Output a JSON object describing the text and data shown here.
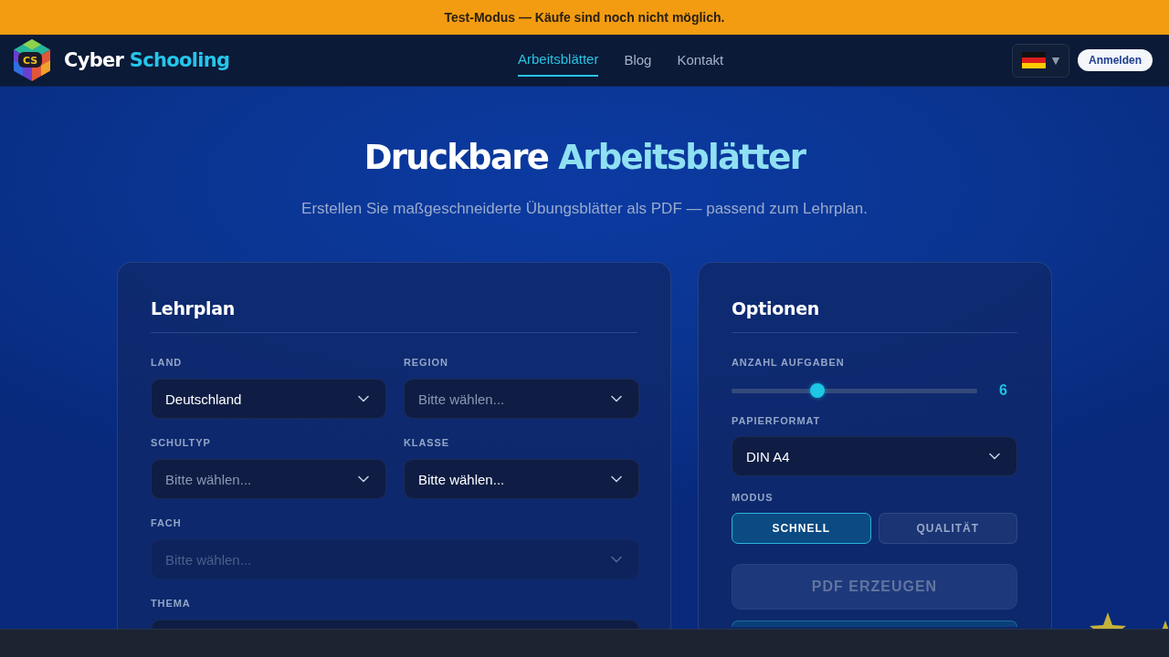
{
  "notice": {
    "text": "Test-Modus — Käufe sind noch nicht möglich."
  },
  "header": {
    "logo": {
      "mark": "CS",
      "name": [
        {
          "text": "Cyber ",
          "accent": false
        },
        {
          "text": "Schooling",
          "accent": true
        }
      ]
    },
    "nav": [
      {
        "label": "Arbeitsblätter",
        "selected": true
      },
      {
        "label": "Blog",
        "selected": false
      },
      {
        "label": "Kontakt",
        "selected": false
      }
    ],
    "language": {
      "caret": "▼"
    },
    "login_button": {
      "label": "Anmelden"
    }
  },
  "hero": {
    "title": [
      {
        "text": "Druckbare ",
        "accent": false
      },
      {
        "text": "Arbeitsblätter",
        "accent": true
      }
    ],
    "subtitle": "Erstellen Sie maßgeschneiderte Übungsblätter als PDF — passend zum Lehrplan."
  },
  "curriculum": {
    "title": "Lehrplan",
    "rows": [
      [
        {
          "label": "LAND",
          "value": "Deutschland",
          "disabled": false
        },
        {
          "label": "REGION",
          "placeholder": "Bitte wählen...",
          "disabled": false
        }
      ],
      [
        {
          "label": "SCHULTYP",
          "placeholder": "Bitte wählen...",
          "disabled": false
        },
        {
          "label": "KLASSE",
          "value": "Bitte wählen...",
          "disabled": false
        }
      ],
      [
        {
          "label": "FACH",
          "placeholder": "Bitte wählen...",
          "disabled": true
        }
      ],
      [
        {
          "label": "THEMA",
          "disabled": false
        }
      ]
    ]
  },
  "options": {
    "title": "Optionen",
    "count": {
      "label": "ANZAHL AUFGABEN",
      "level": 0.34,
      "reading": "6"
    },
    "paper": {
      "label": "PAPIERFORMAT",
      "value": "DIN A4"
    },
    "mode": {
      "label": "MODUS",
      "options": [
        {
          "label": "SCHNELL",
          "selected": true
        },
        {
          "label": "QUALITÄT",
          "selected": false
        }
      ]
    },
    "generate_button": {
      "label": "PDF ERZEUGEN",
      "disabled": true
    }
  }
}
